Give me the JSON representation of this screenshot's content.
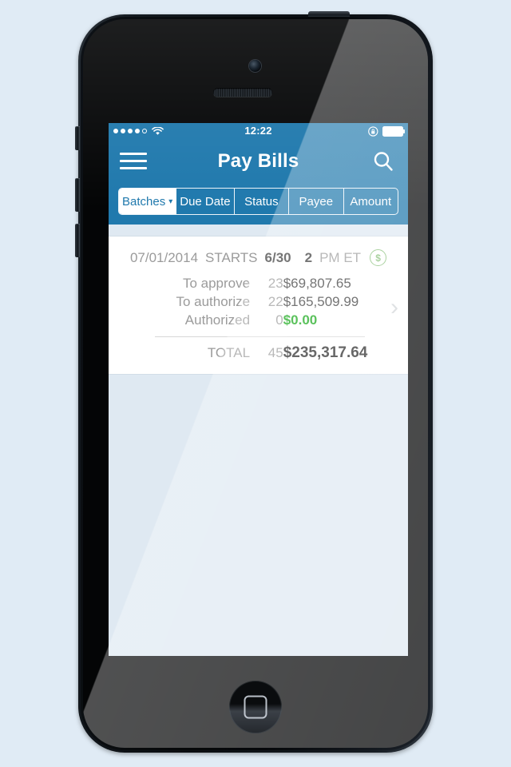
{
  "device": {
    "hardware": {
      "camera": "front-camera",
      "speaker": "earpiece-speaker",
      "home_button": "home-button",
      "power_button": "power-button",
      "mute_switch": "mute-switch",
      "volume_up": "volume-up-button",
      "volume_down": "volume-down-button"
    }
  },
  "colors": {
    "brand_blue": "#2079ad",
    "page_bg": "#e0ebf5",
    "screen_bg": "#dfe9f2",
    "card_bg": "#ffffff",
    "green": "#16a818",
    "badge_green": "#88c07a",
    "muted_text": "#9b9b9b",
    "dark_text": "#3b3b3b"
  },
  "statusbar": {
    "signal_dots_filled": 4,
    "signal_dots_total": 5,
    "wifi_icon": "wifi-icon",
    "time": "12:22",
    "rotation_lock_icon": "rotation-lock-icon",
    "battery_icon": "battery-icon"
  },
  "navbar": {
    "menu_icon": "hamburger-menu-icon",
    "title": "Pay Bills",
    "search_icon": "search-icon"
  },
  "segmented_control": {
    "items": [
      {
        "label": "Batches",
        "caret": "▾",
        "active": true
      },
      {
        "label": "Due Date",
        "caret": "",
        "active": false
      },
      {
        "label": "Status",
        "caret": "",
        "active": false
      },
      {
        "label": "Payee",
        "caret": "",
        "active": false
      },
      {
        "label": "Amount",
        "caret": "",
        "active": false
      }
    ]
  },
  "batch_card": {
    "date": "07/01/2014",
    "starts_label": "STARTS",
    "starts_day": "6/30",
    "starts_time": "2",
    "starts_time_unit": "PM ET",
    "badge_icon": "dollar-circle-icon",
    "chevron_icon": "chevron-right-icon",
    "rows": [
      {
        "label": "To approve",
        "count": "23",
        "amount": "$69,807.65",
        "green": false
      },
      {
        "label": "To authorize",
        "count": "22",
        "amount": "$165,509.99",
        "green": false
      },
      {
        "label": "Authorized",
        "count": "0",
        "amount": "$0.00",
        "green": true
      }
    ],
    "total": {
      "label": "TOTAL",
      "count": "45",
      "amount": "$235,317.64"
    }
  }
}
